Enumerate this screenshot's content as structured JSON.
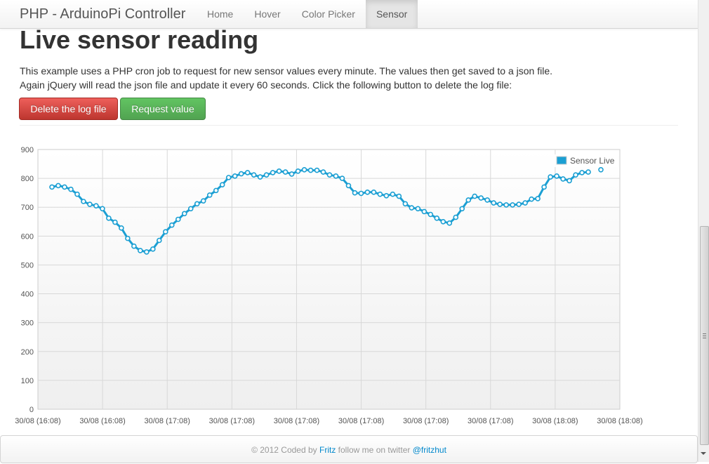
{
  "navbar": {
    "brand": "PHP - ArduinoPi Controller",
    "items": [
      {
        "label": "Home",
        "active": false
      },
      {
        "label": "Hover",
        "active": false
      },
      {
        "label": "Color Picker",
        "active": false
      },
      {
        "label": "Sensor",
        "active": true
      }
    ]
  },
  "main": {
    "title": "Live sensor reading",
    "description_line1": "This example uses a PHP cron job to request for new sensor values every minute. The values then get saved to a json file.",
    "description_line2": "Again jQuery will read the json file and update it every 60 seconds. Click the following button to delete the log file:",
    "delete_button": "Delete the log file",
    "request_button": "Request value"
  },
  "colors": {
    "danger": "#da4f49",
    "success": "#5bb75b",
    "series": "#1b9fd3",
    "link": "#0088cc"
  },
  "chart_data": {
    "type": "line",
    "series": [
      {
        "name": "Sensor Live",
        "values": [
          770,
          775,
          770,
          762,
          745,
          720,
          710,
          705,
          695,
          662,
          648,
          628,
          592,
          565,
          550,
          545,
          555,
          585,
          615,
          638,
          658,
          678,
          695,
          712,
          722,
          742,
          758,
          778,
          803,
          808,
          816,
          820,
          812,
          805,
          812,
          820,
          825,
          822,
          815,
          825,
          830,
          828,
          828,
          822,
          812,
          808,
          800,
          775,
          750,
          748,
          752,
          752,
          745,
          740,
          745,
          738,
          712,
          698,
          695,
          685,
          675,
          662,
          650,
          645,
          665,
          695,
          725,
          738,
          732,
          725,
          715,
          710,
          708,
          708,
          710,
          715,
          728,
          730,
          770,
          805,
          808,
          798,
          792,
          812,
          820,
          822,
          null,
          830
        ]
      }
    ],
    "x_tick_labels": [
      "30/08 (16:08)",
      "30/08 (16:08)",
      "30/08 (17:08)",
      "30/08 (17:08)",
      "30/08 (17:08)",
      "30/08 (17:08)",
      "30/08 (17:08)",
      "30/08 (17:08)",
      "30/08 (18:08)",
      "30/08 (18:08)"
    ],
    "y_ticks": [
      0,
      100,
      200,
      300,
      400,
      500,
      600,
      700,
      800,
      900
    ],
    "ylim": [
      0,
      900
    ],
    "grid": true,
    "legend_position": "top-right",
    "title": "",
    "xlabel": "",
    "ylabel": ""
  },
  "footer": {
    "prefix": "© 2012 Coded by",
    "author": "Fritz",
    "middle": "follow me on twitter",
    "twitter": "@fritzhut"
  }
}
